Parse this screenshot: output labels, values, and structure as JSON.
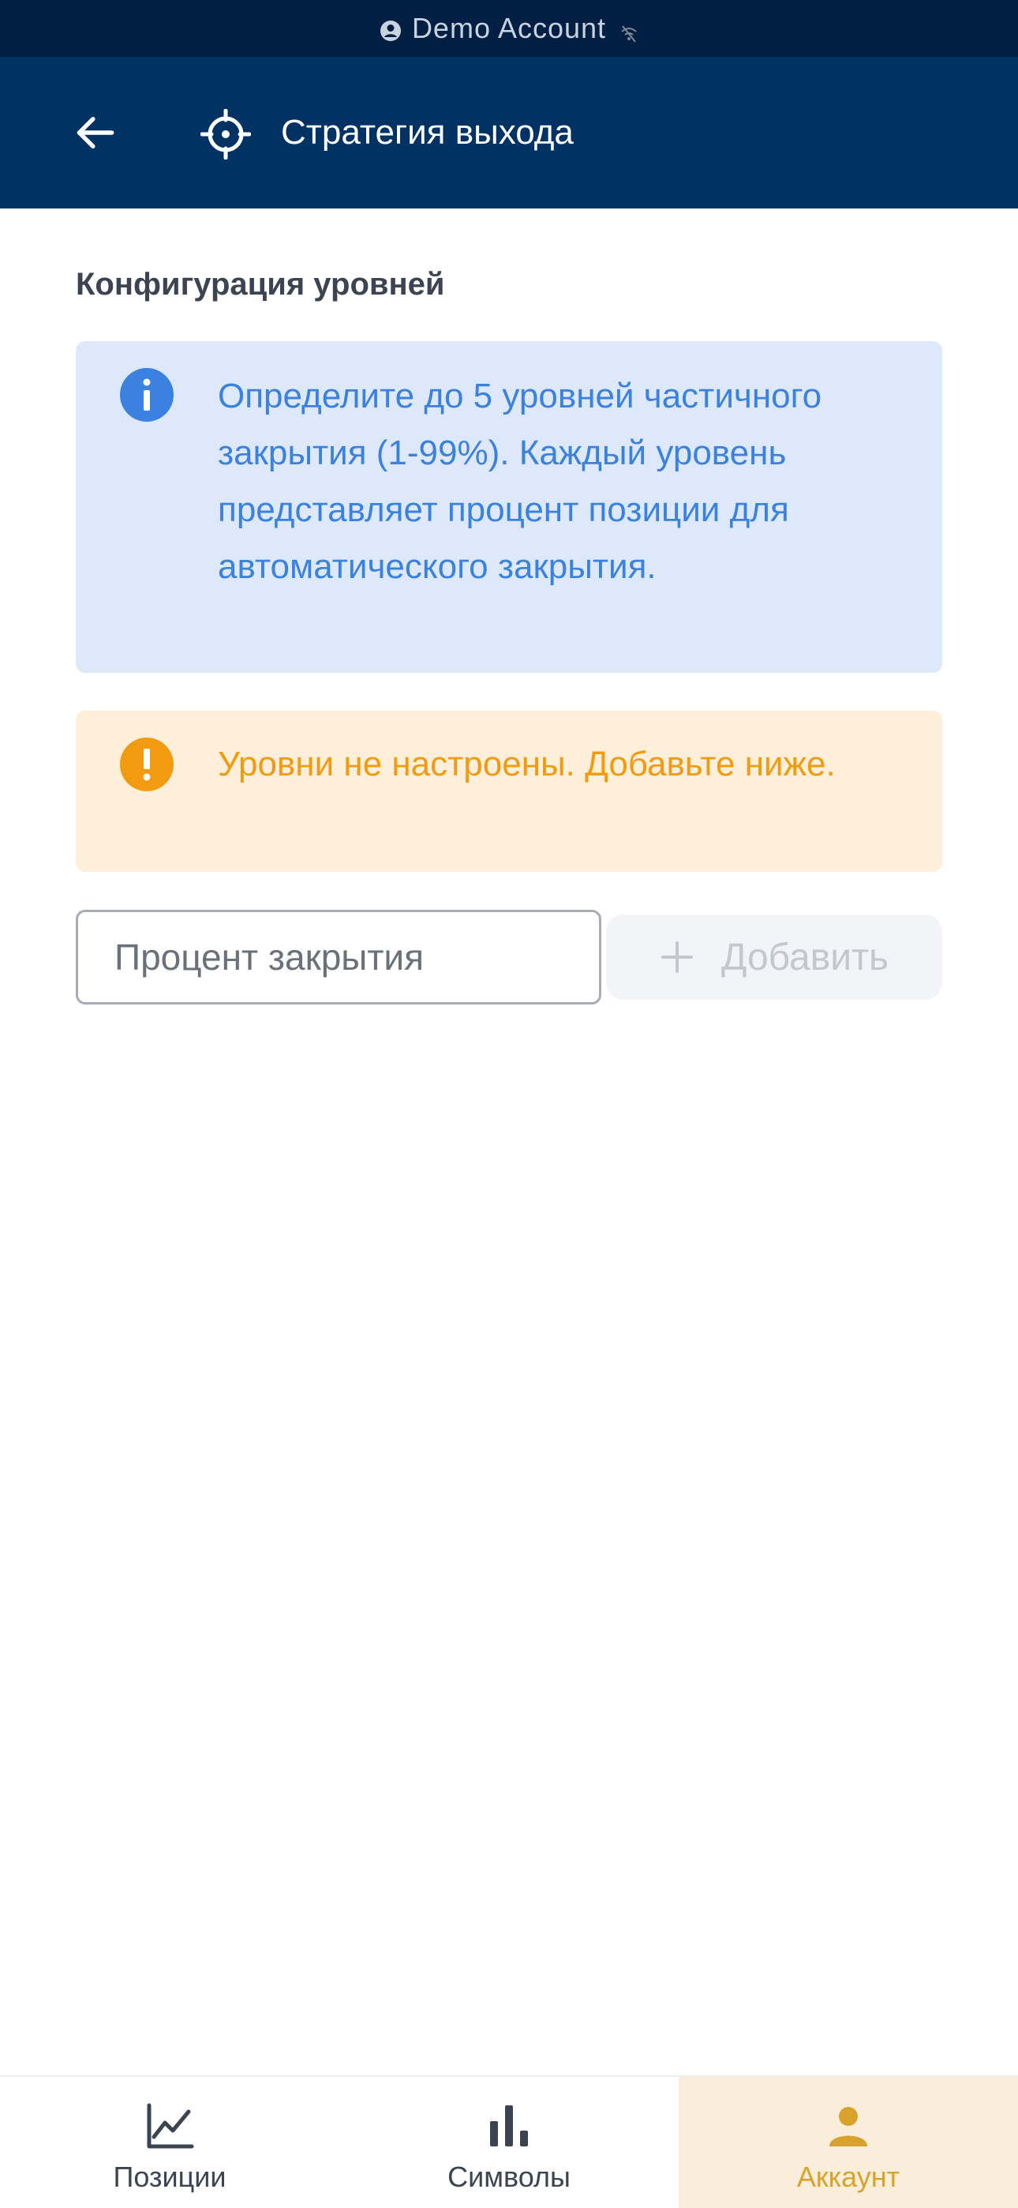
{
  "status_bar": {
    "account_label": "Demo Account",
    "account_icon": "account-circle-icon",
    "network_icon": "wifi-off-icon"
  },
  "app_bar": {
    "back_icon": "arrow-left-icon",
    "title_icon": "crosshair-target-icon",
    "title": "Стратегия выхода"
  },
  "content": {
    "section_title": "Конфигурация уровней",
    "info_card": {
      "icon": "info-icon",
      "text": "Определите до 5 уровней частичного закрытия (1-99%). Каждый уровень представляет процент позиции для автоматического закрытия."
    },
    "warning_card": {
      "icon": "exclamation-icon",
      "text": "Уровни не настроены. Добавьте ниже."
    },
    "percent_input": {
      "placeholder": "Процент закрытия",
      "value": ""
    },
    "add_button": {
      "icon": "plus-icon",
      "label": "Добавить",
      "disabled": true
    }
  },
  "bottom_nav": {
    "items": [
      {
        "label": "Позиции",
        "icon": "line-chart-icon",
        "active": false
      },
      {
        "label": "Символы",
        "icon": "bar-chart-icon",
        "active": false
      },
      {
        "label": "Аккаунт",
        "icon": "person-icon",
        "active": true
      }
    ]
  },
  "colors": {
    "status_bar_bg": "#001f43",
    "app_bar_bg": "#003264",
    "info_bg": "#dde9fb",
    "info_accent": "#3b82e0",
    "warning_bg": "#fdefd9",
    "warning_accent": "#f29b10",
    "active_nav_bg": "#faeedb",
    "active_nav_accent": "#d7a32b"
  }
}
